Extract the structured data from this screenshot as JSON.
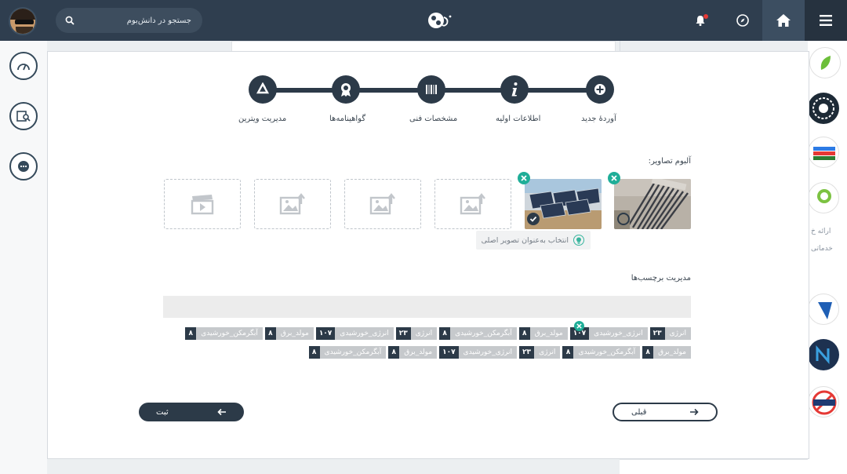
{
  "topbar": {
    "search_placeholder": "جستجو در دانش‌بوم",
    "notification_badge": true
  },
  "stepper": {
    "steps": [
      {
        "label": "آوردهٔ جدید",
        "icon": "plus-circle-icon"
      },
      {
        "label": "اطلاعات اولیه",
        "icon": "info-icon"
      },
      {
        "label": "مشخصات فنی",
        "icon": "barcode-icon"
      },
      {
        "label": "گواهینامه‌ها",
        "icon": "award-icon"
      },
      {
        "label": "مدیریت ویترین",
        "icon": "recycle-icon"
      }
    ]
  },
  "album": {
    "title": "آلبوم تصاویر:",
    "main_select_label": "انتخاب به‌عنوان تصویر اصلی"
  },
  "tags": {
    "title": "مدیریت برچسب‌ها",
    "input_value": "",
    "row1": [
      {
        "text": "انرژی",
        "count": "۲۳"
      },
      {
        "text": "انرژی_خورشیدی",
        "count": "۱۰۷"
      },
      {
        "text": "مولد_برق",
        "count": "۸"
      },
      {
        "text": "آبگرمکن_خورشیدی",
        "count": "۸"
      },
      {
        "text": "انرژی",
        "count": "۲۳"
      },
      {
        "text": "انرژی_خورشیدی",
        "count": "۱۰۷"
      },
      {
        "text": "مولد_برق",
        "count": "۸"
      },
      {
        "text": "آبگرمکن_خورشیدی",
        "count": "۸"
      }
    ],
    "row2": [
      {
        "text": "مولد_برق",
        "count": "۸"
      },
      {
        "text": "آبگرمکن_خورشیدی",
        "count": "۸"
      },
      {
        "text": "انرژی",
        "count": "۲۳"
      },
      {
        "text": "انرژی_خورشیدی",
        "count": "۱۰۷"
      },
      {
        "text": "مولد_برق",
        "count": "۸"
      },
      {
        "text": "آبگرمکن_خورشیدی",
        "count": "۸"
      }
    ]
  },
  "footer": {
    "submit_label": "ثبت",
    "prev_label": "قبلی"
  },
  "rightrail": {
    "text1": "ارائه خ",
    "text2": "خدماتی"
  },
  "colors": {
    "navbar": "#2f3e4f",
    "primary": "#2c3a48",
    "accent": "#1fae98",
    "tag_bg": "#c6c9cc"
  }
}
